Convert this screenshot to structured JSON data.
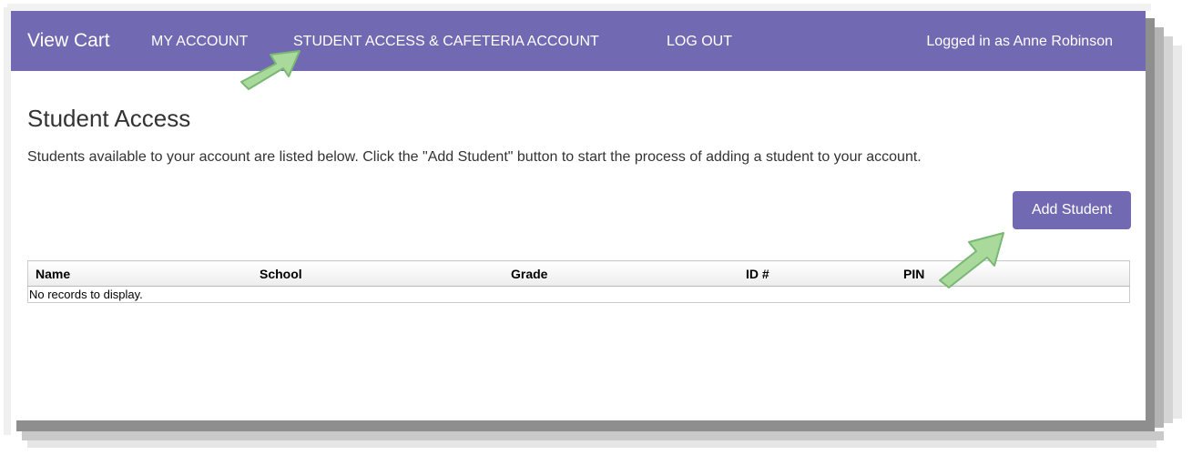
{
  "navbar": {
    "brand": "View Cart",
    "links": [
      {
        "label": "MY ACCOUNT"
      },
      {
        "label": "STUDENT ACCESS & CAFETERIA ACCOUNT"
      },
      {
        "label": "LOG OUT"
      }
    ],
    "user_status": "Logged in as Anne Robinson"
  },
  "main": {
    "title": "Student Access",
    "intro": "Students available to your account are listed below. Click the \"Add Student\" button to start the process of adding a student to your account.",
    "add_button_label": "Add Student"
  },
  "table": {
    "columns": [
      "Name",
      "School",
      "Grade",
      "ID #",
      "PIN"
    ],
    "empty_message": "No records to display."
  },
  "annotations": {
    "arrow_icon": "arrow-up-right-icon",
    "arrow_color": "#a9d99b"
  },
  "colors": {
    "accent": "#7169b1",
    "text": "#333333"
  }
}
